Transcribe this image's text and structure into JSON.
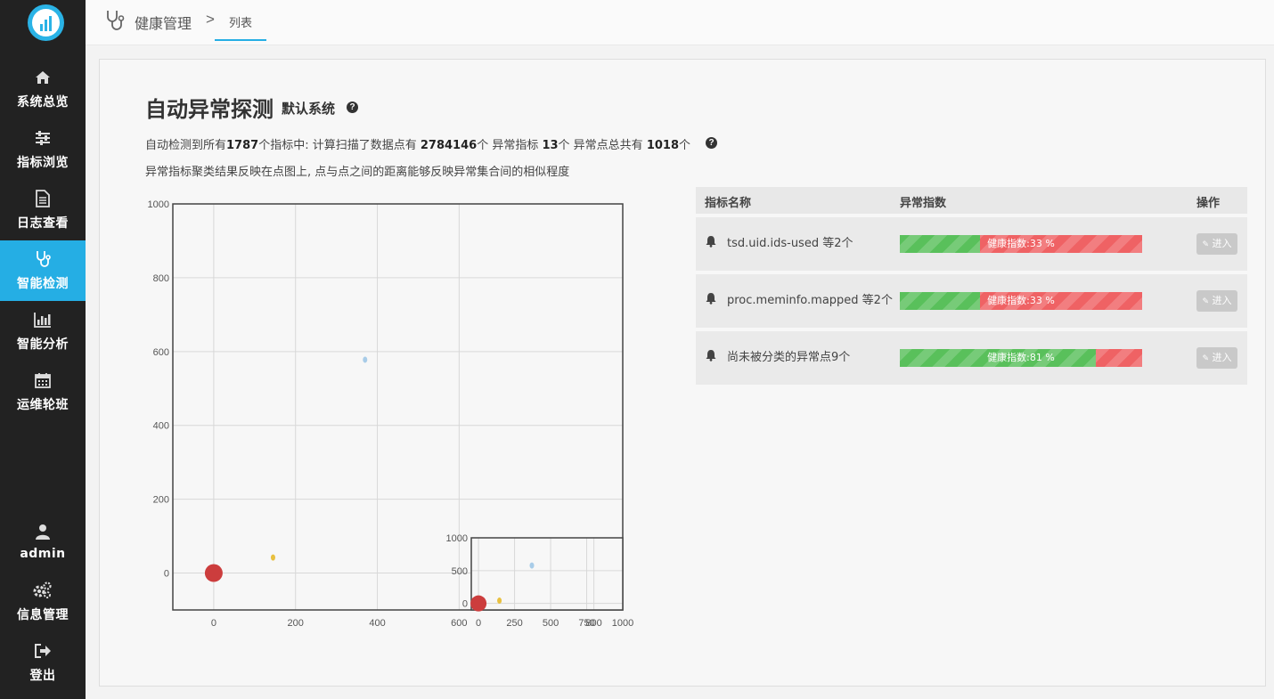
{
  "sidebar": {
    "items": [
      {
        "label": "系统总览",
        "icon": "home-icon"
      },
      {
        "label": "指标浏览",
        "icon": "sliders-icon"
      },
      {
        "label": "日志查看",
        "icon": "document-icon"
      },
      {
        "label": "智能检测",
        "icon": "stethoscope-icon",
        "active": true
      },
      {
        "label": "智能分析",
        "icon": "bar-chart-icon"
      },
      {
        "label": "运维轮班",
        "icon": "calendar-icon"
      }
    ],
    "user": {
      "label": "admin",
      "icon": "user-icon"
    },
    "settings": {
      "label": "信息管理",
      "icon": "gears-icon"
    },
    "logout": {
      "label": "登出",
      "icon": "sign-out-icon"
    }
  },
  "breadcrumb": {
    "root": "健康管理",
    "separator": ">",
    "current": "列表"
  },
  "page": {
    "title": "自动异常探测",
    "subtitle": "默认系统",
    "summary": {
      "t1": "自动检测到所有",
      "metrics_total": "1787",
      "t2": "个指标中: 计算扫描了数据点有 ",
      "points_scanned": "2784146",
      "t3": "个 异常指标 ",
      "anomalous_metrics": "13",
      "t4": "个 异常点总共有 ",
      "anomaly_points": "1018",
      "t5": "个"
    },
    "description": "异常指标聚类结果反映在点图上, 点与点之间的距离能够反映异常集合间的相似程度"
  },
  "chart_data": [
    {
      "type": "scatter",
      "title": "",
      "xlim": [
        -100,
        1000
      ],
      "ylim": [
        -100,
        1000
      ],
      "x_ticks": [
        "0",
        "200",
        "400",
        "600"
      ],
      "y_ticks": [
        "0",
        "200",
        "400",
        "600",
        "800",
        "1000"
      ],
      "grid": true,
      "points": [
        {
          "x": 0,
          "y": 0,
          "size": "large",
          "color": "#cc3d3d"
        },
        {
          "x": 145,
          "y": 42,
          "size": "small",
          "color": "#e8c040"
        },
        {
          "x": 370,
          "y": 578,
          "size": "small",
          "color": "#a8cce8"
        }
      ]
    },
    {
      "type": "scatter",
      "title": "",
      "xlim": [
        -50,
        1000
      ],
      "ylim": [
        -100,
        1000
      ],
      "x_ticks": [
        "0",
        "250",
        "500",
        "750",
        "1000"
      ],
      "y_ticks": [
        "0",
        "500",
        "1000"
      ],
      "extra_x_label": "800",
      "grid": true,
      "points": [
        {
          "x": 0,
          "y": 0,
          "size": "large",
          "color": "#cc3d3d"
        },
        {
          "x": 145,
          "y": 42,
          "size": "small",
          "color": "#e8c040"
        },
        {
          "x": 370,
          "y": 578,
          "size": "small",
          "color": "#a8cce8"
        }
      ]
    }
  ],
  "table": {
    "headers": [
      "指标名称",
      "异常指数",
      "操作"
    ],
    "rows": [
      {
        "name": "tsd.uid.ids-used 等2个",
        "health_label": "健康指数:33 %",
        "health": 0.33,
        "action": "进入"
      },
      {
        "name": "proc.meminfo.mapped 等2个",
        "health_label": "健康指数:33 %",
        "health": 0.33,
        "action": "进入"
      },
      {
        "name": "尚未被分类的异常点9个",
        "health_label": "健康指数:81 %",
        "health": 0.81,
        "action": "进入"
      }
    ]
  },
  "colors": {
    "accent": "#25aee4",
    "sidebar": "#222222",
    "bar_green": "#59c05b",
    "bar_red": "#ef6264",
    "dot_red": "#cc3d3d"
  }
}
